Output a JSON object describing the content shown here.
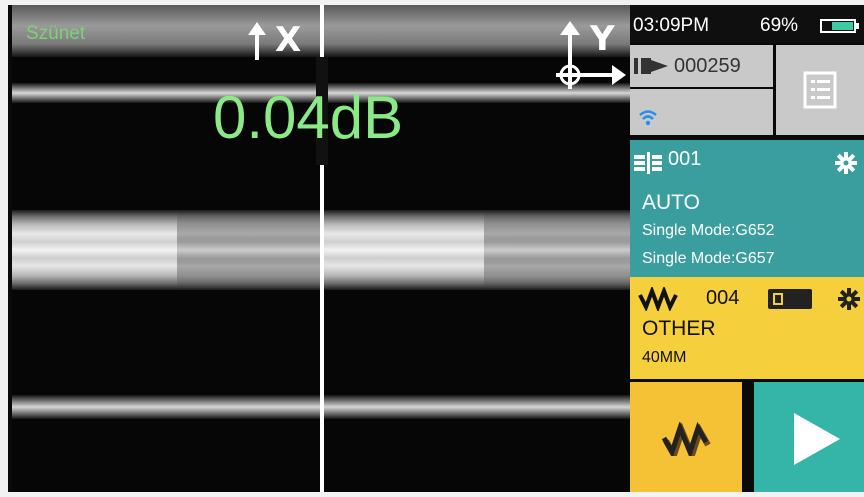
{
  "status": {
    "state_text": "Szünet"
  },
  "measurement": {
    "loss_value": "0.04dB"
  },
  "axes": {
    "x_label": "X",
    "y_label": "Y"
  },
  "header": {
    "time": "03:09PM",
    "battery": "69%"
  },
  "counter": {
    "value": "000259"
  },
  "splice_program": {
    "number": "001",
    "mode": "AUTO",
    "fiber_left": "Single Mode:G652",
    "fiber_right": "Single Mode:G657"
  },
  "heater_program": {
    "number": "004",
    "mode": "OTHER",
    "sleeve_length": "40MM"
  },
  "colors": {
    "splice_panel": "#3b9e9e",
    "heater_panel": "#f6cf3c",
    "start_button": "#35b5a8",
    "loss_text": "#8bea86",
    "status_text": "#7ed07a"
  },
  "icons": {
    "counter": "electrode-counter-icon",
    "wifi": "wifi-icon",
    "menu": "menu-list-icon",
    "splice": "splice-program-icon",
    "settings": "gear-icon",
    "heater": "heater-wave-icon",
    "start": "play-icon"
  }
}
